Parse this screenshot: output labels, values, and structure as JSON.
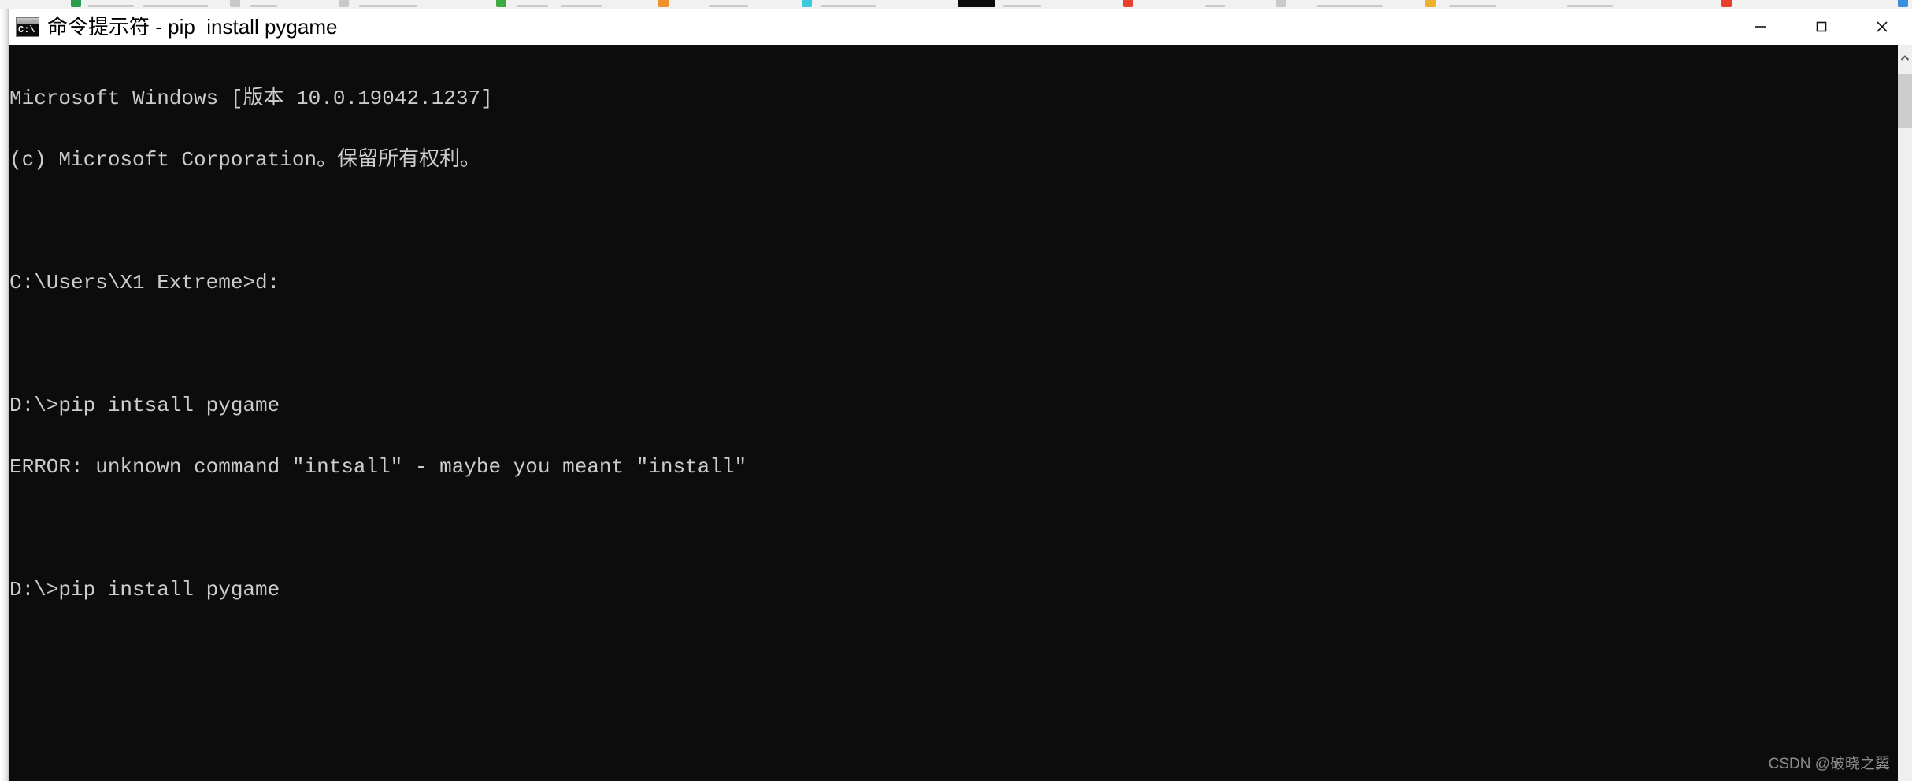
{
  "window": {
    "app_icon": "cmd-icon",
    "icon_text": "C:\\",
    "title": "命令提示符 - pip  install pygame",
    "controls": {
      "minimize": "minimize-icon",
      "maximize": "maximize-icon",
      "close": "close-icon"
    }
  },
  "console": {
    "background_color": "#0c0c0c",
    "text_color": "#cccccc",
    "lines": [
      "Microsoft Windows [版本 10.0.19042.1237]",
      "(c) Microsoft Corporation。保留所有权利。",
      "",
      "C:\\Users\\X1 Extreme>d:",
      "",
      "D:\\>pip intsall pygame",
      "ERROR: unknown command ″intsall″ - maybe you meant ″install″",
      "",
      "D:\\>pip install pygame"
    ]
  },
  "scrollbar": {
    "up_arrow": "chevron-up-icon",
    "thumb_label": "vertical-scroll-thumb"
  },
  "watermark": {
    "text": "CSDN @破晓之翼"
  },
  "top_strip": {
    "label": "partially-visible-browser-tab-strip"
  }
}
